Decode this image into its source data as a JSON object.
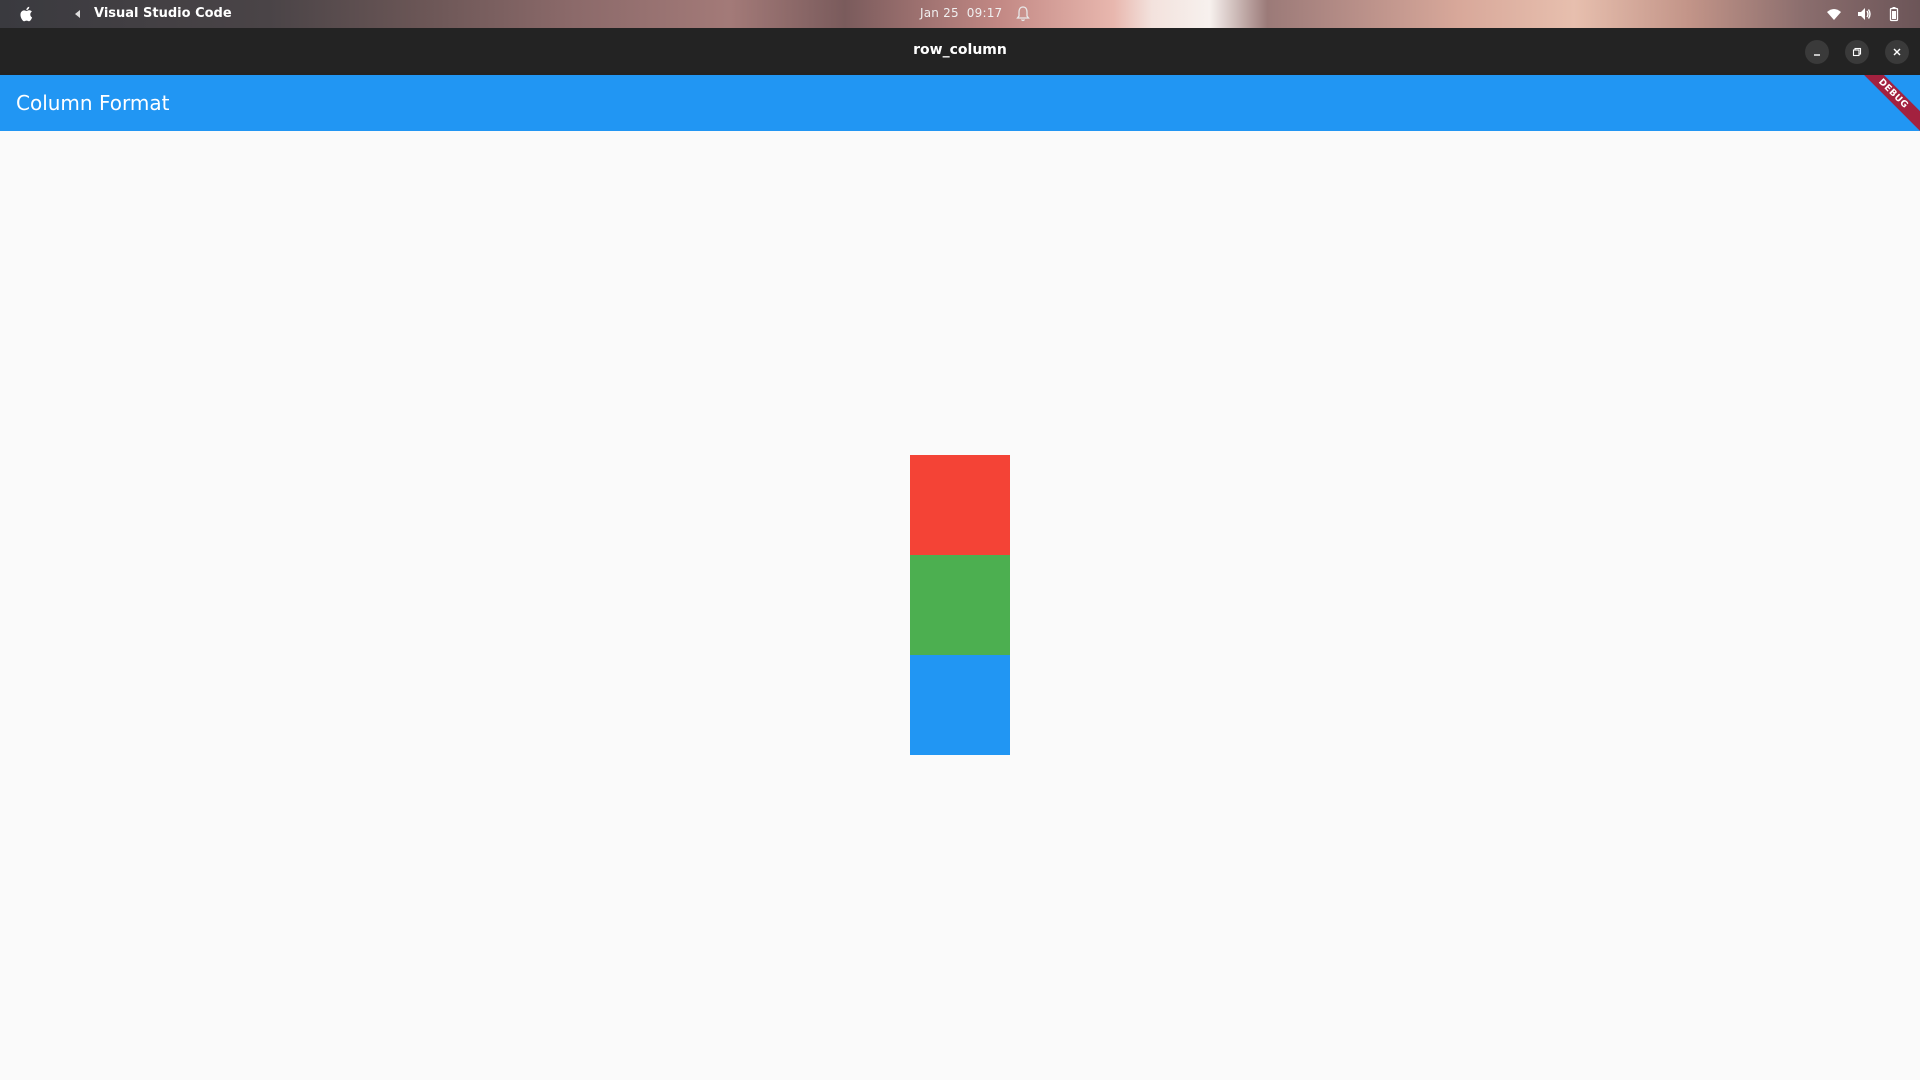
{
  "system_bar": {
    "app_name": "Visual Studio Code",
    "date": "Jan 25",
    "time": "09:17",
    "icons": [
      "apple-icon",
      "app-indicator-icon",
      "bell-icon",
      "wifi-icon",
      "volume-icon",
      "battery-icon"
    ]
  },
  "window": {
    "title": "row_column",
    "controls": [
      "minimize-icon",
      "maximize-icon",
      "close-icon"
    ]
  },
  "app_bar": {
    "title": "Column Format",
    "color": "#2196f3",
    "debug_label": "DEBUG"
  },
  "column": {
    "boxes": [
      {
        "name": "red-box",
        "color": "#f44336"
      },
      {
        "name": "green-box",
        "color": "#4caf50"
      },
      {
        "name": "blue-box",
        "color": "#2196f3"
      }
    ]
  }
}
